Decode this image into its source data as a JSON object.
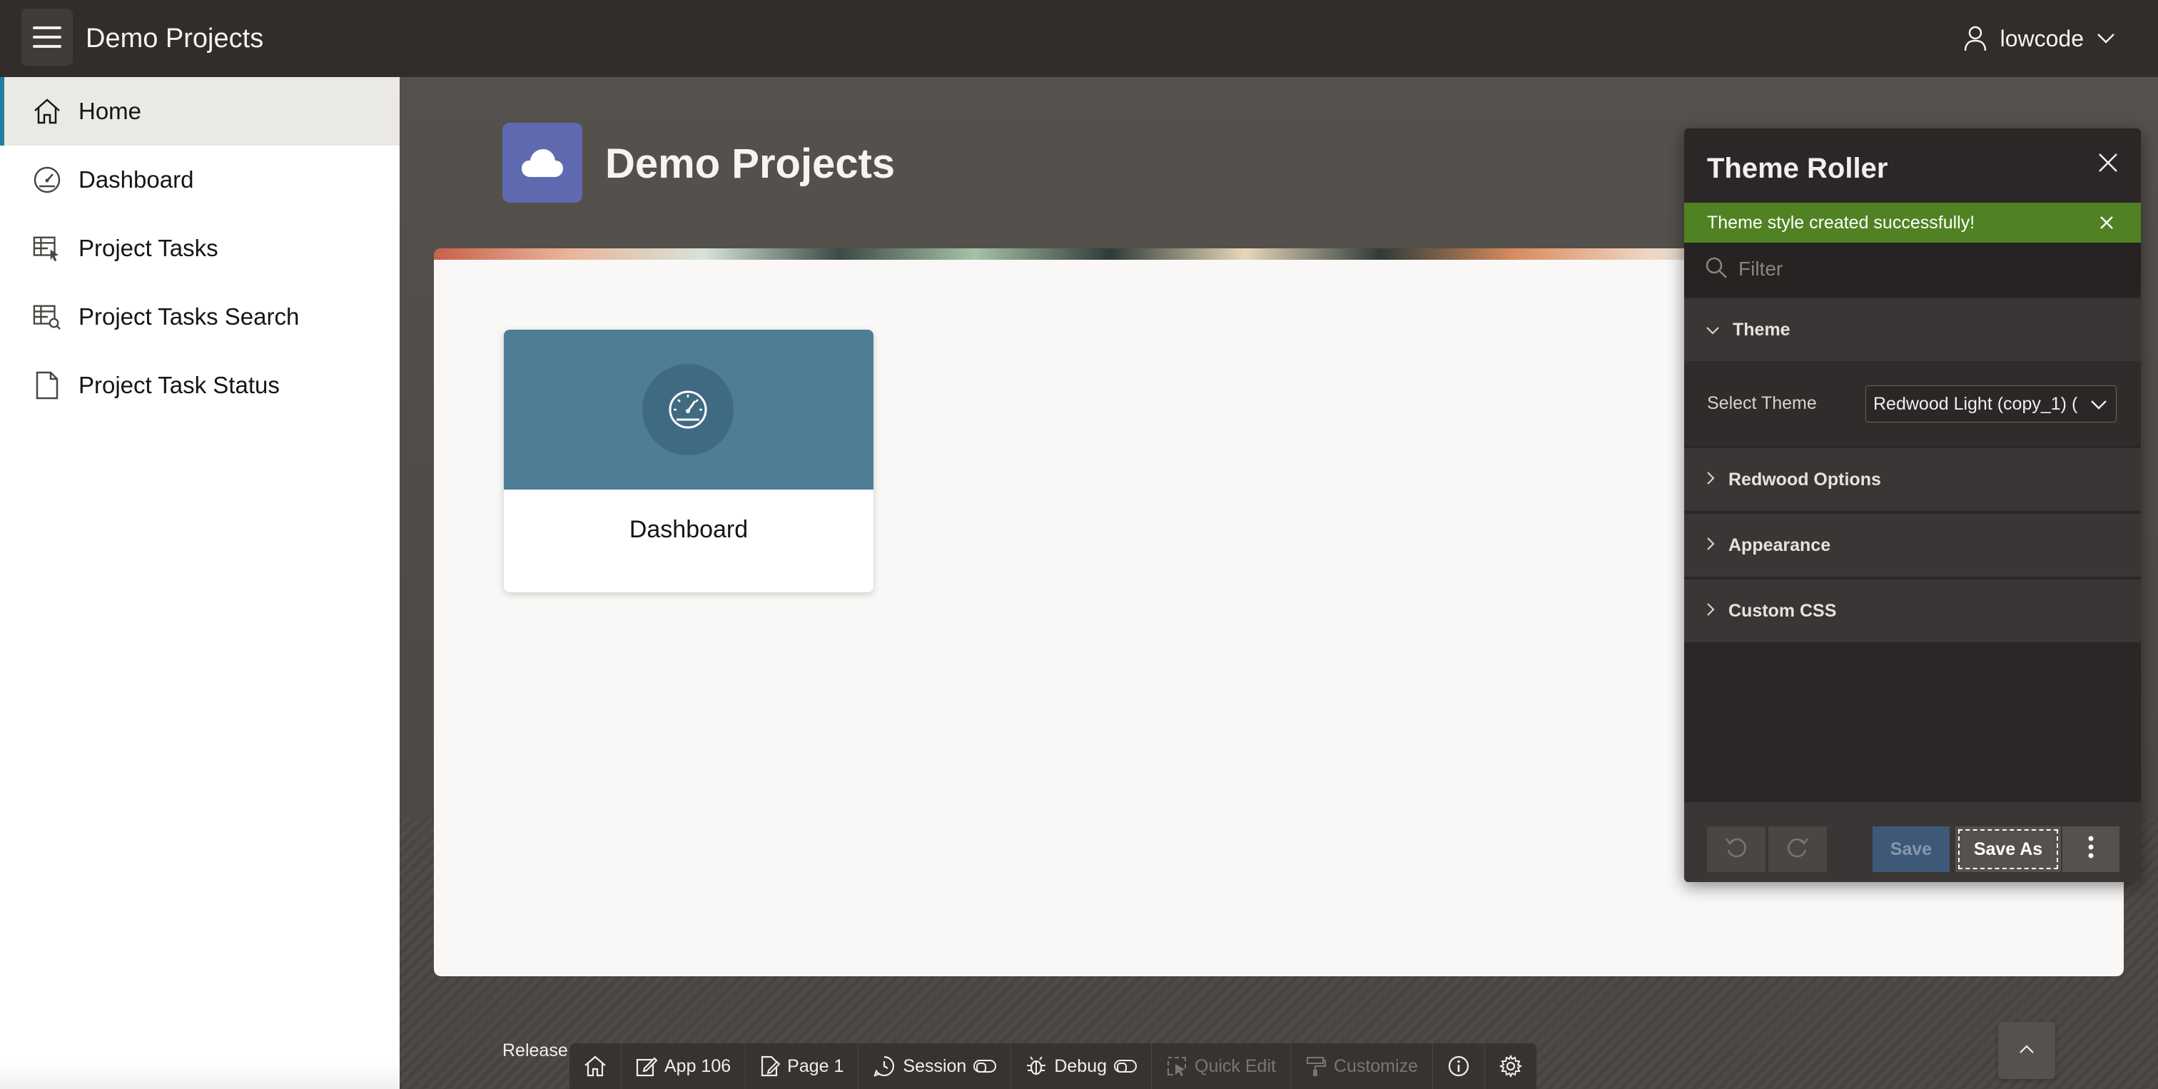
{
  "header": {
    "app_title": "Demo Projects",
    "user_name": "lowcode"
  },
  "sidebar": {
    "items": [
      {
        "label": "Home",
        "icon": "home-icon",
        "active": true
      },
      {
        "label": "Dashboard",
        "icon": "speedometer-icon",
        "active": false
      },
      {
        "label": "Project Tasks",
        "icon": "table-pointer-icon",
        "active": false
      },
      {
        "label": "Project Tasks Search",
        "icon": "table-search-icon",
        "active": false
      },
      {
        "label": "Project Task Status",
        "icon": "file-icon",
        "active": false
      }
    ]
  },
  "hero": {
    "title": "Demo Projects",
    "icon": "cloud-icon"
  },
  "cards": [
    {
      "label": "Dashboard",
      "icon": "speedometer-icon"
    }
  ],
  "theme_roller": {
    "title": "Theme Roller",
    "alert": "Theme style created successfully!",
    "filter_placeholder": "Filter",
    "sections": {
      "theme": "Theme",
      "redwood_options": "Redwood Options",
      "appearance": "Appearance",
      "custom_css": "Custom CSS"
    },
    "select_theme_label": "Select Theme",
    "select_theme_value": "Redwood Light (copy_1) (",
    "buttons": {
      "save": "Save",
      "save_as": "Save As"
    }
  },
  "devbar": {
    "release": "Release",
    "app": "App 106",
    "page": "Page 1",
    "session": "Session",
    "debug": "Debug",
    "quick_edit": "Quick Edit",
    "customize": "Customize"
  },
  "colors": {
    "header_bg": "#312d2a",
    "accent": "#227e9e",
    "hero_icon_bg": "#5f6ab0",
    "card_top": "#4e7d96",
    "success": "#508223",
    "save_button": "#3e5878"
  }
}
